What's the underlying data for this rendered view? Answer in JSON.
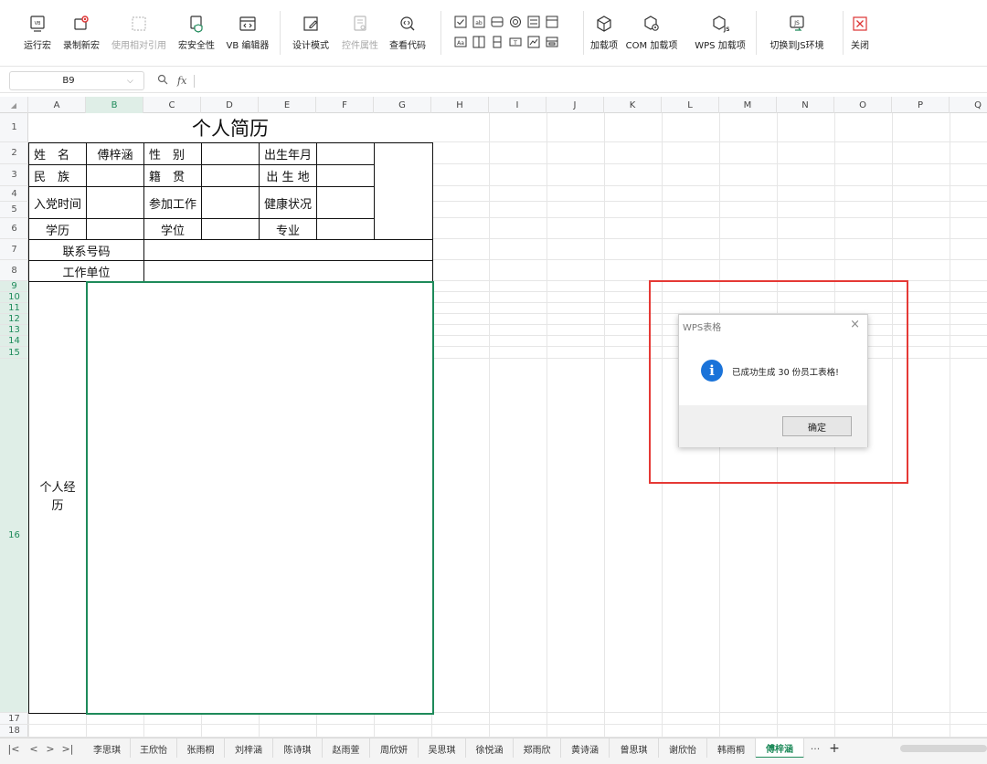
{
  "ribbon": {
    "buttons": [
      {
        "label": "运行宏",
        "icon": "run-macro-icon"
      },
      {
        "label": "录制新宏",
        "icon": "record-macro-icon"
      },
      {
        "label": "使用相对引用",
        "icon": "relative-reference-icon",
        "disabled": true
      },
      {
        "label": "宏安全性",
        "icon": "macro-security-icon"
      },
      {
        "label": "VB 编辑器",
        "icon": "vb-editor-icon"
      },
      {
        "label": "设计模式",
        "icon": "design-mode-icon"
      },
      {
        "label": "控件属性",
        "icon": "control-properties-icon",
        "disabled": true
      },
      {
        "label": "查看代码",
        "icon": "view-code-icon"
      },
      {
        "label": "加载项",
        "icon": "addins-icon"
      },
      {
        "label": "COM 加载项",
        "icon": "com-addins-icon"
      },
      {
        "label": "WPS 加载项",
        "icon": "wps-addins-icon"
      },
      {
        "label": "切换到JS环境",
        "icon": "js-environment-icon"
      },
      {
        "label": "关闭",
        "icon": "close-icon"
      }
    ]
  },
  "formula_bar": {
    "name_box": "B9",
    "fx": "fx",
    "formula": ""
  },
  "columns": [
    "A",
    "B",
    "C",
    "D",
    "E",
    "F",
    "G",
    "H",
    "I",
    "J",
    "K",
    "L",
    "M",
    "N",
    "O",
    "P",
    "Q"
  ],
  "rows": [
    "1",
    "2",
    "3",
    "4",
    "5",
    "6",
    "7",
    "8",
    "9",
    "10",
    "11",
    "12",
    "13",
    "14",
    "15",
    "16",
    "17",
    "18"
  ],
  "sheet": {
    "title": "个人简历",
    "labels": {
      "name": "姓　名",
      "name_value": "傅梓涵",
      "gender": "性　别",
      "birth": "出生年月",
      "ethnicity": "民　族",
      "native": "籍　贯",
      "birthplace": "出 生 地",
      "party": "入党时间",
      "work_start": "参加工作",
      "health": "健康状况",
      "education": "学历",
      "degree": "学位",
      "major": "专业",
      "phone": "联系号码",
      "employer": "工作单位",
      "experience": "个人经历"
    }
  },
  "dialog": {
    "title": "WPS表格",
    "message": "已成功生成 30 份员工表格!",
    "ok": "确定",
    "close": "×",
    "info": "i"
  },
  "tabs": {
    "nav": [
      "|<",
      "<",
      ">",
      ">|"
    ],
    "items": [
      "李思琪",
      "王欣怡",
      "张雨桐",
      "刘梓涵",
      "陈诗琪",
      "赵雨萱",
      "周欣妍",
      "吴思琪",
      "徐悦涵",
      "郑雨欣",
      "黄诗涵",
      "曾思琪",
      "谢欣怡",
      "韩雨桐",
      "傅梓涵"
    ],
    "active": "傅梓涵",
    "more": "···",
    "add": "+"
  }
}
